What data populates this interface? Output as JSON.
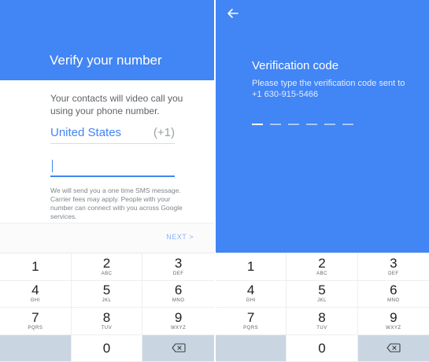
{
  "left_screen": {
    "title": "Verify your number",
    "description": "Your contacts will video call you using your phone number.",
    "country": {
      "name": "United States",
      "code": "(+1)"
    },
    "phone_input": {
      "value": "",
      "placeholder": ""
    },
    "fine_print": "We will send you a one time SMS message. Carrier fees may apply. People with your number can connect with you across Google services.",
    "next_label": "NEXT",
    "next_chevron": ">"
  },
  "right_screen": {
    "title": "Verification code",
    "subtitle": "Please type the verification code sent to +1 630-915-5466",
    "code_length": 6,
    "back_icon": "arrow-left-icon"
  },
  "keypad": {
    "keys": [
      {
        "num": "1",
        "letters": ""
      },
      {
        "num": "2",
        "letters": "ABC"
      },
      {
        "num": "3",
        "letters": "DEF"
      },
      {
        "num": "4",
        "letters": "GHI"
      },
      {
        "num": "5",
        "letters": "JKL"
      },
      {
        "num": "6",
        "letters": "MNO"
      },
      {
        "num": "7",
        "letters": "PQRS"
      },
      {
        "num": "8",
        "letters": "TUV"
      },
      {
        "num": "9",
        "letters": "WXYZ"
      },
      {
        "num": "",
        "letters": ""
      },
      {
        "num": "0",
        "letters": ""
      },
      {
        "num": "",
        "letters": ""
      }
    ],
    "backspace_icon": "backspace-icon"
  },
  "colors": {
    "brand_blue": "#4285f4",
    "key_gray": "#c9d6e2",
    "code_slot": "#a8c7fa"
  }
}
